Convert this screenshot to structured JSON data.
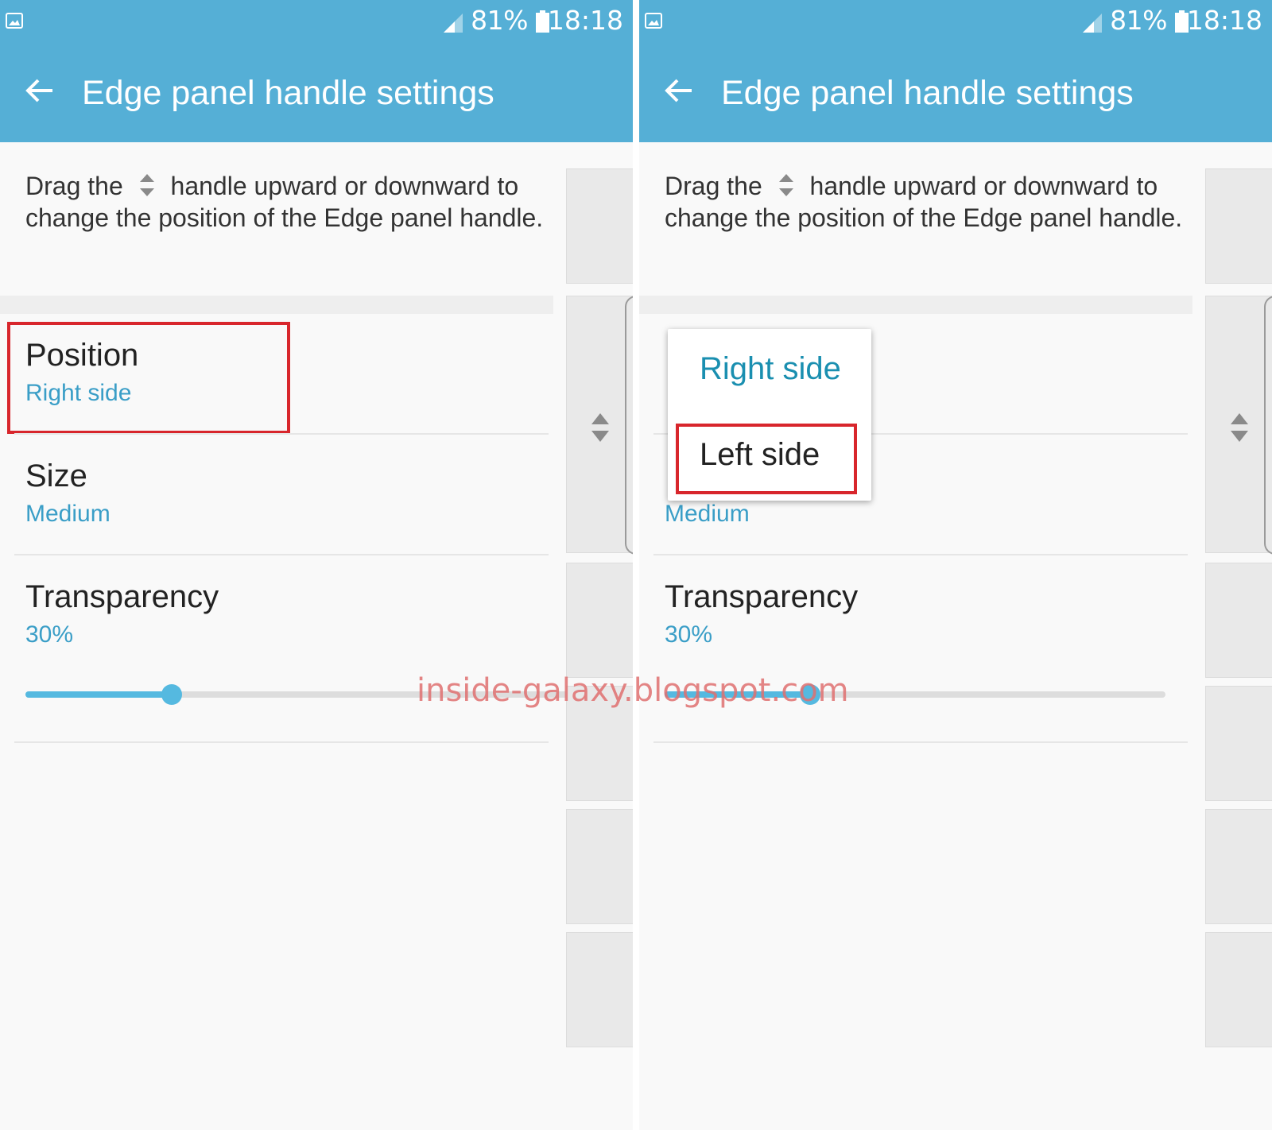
{
  "status_bar": {
    "battery": "81%",
    "time": "18:18"
  },
  "app_bar": {
    "title": "Edge panel handle settings"
  },
  "hint": {
    "part1": "Drag the",
    "part2": "handle upward or downward to change the position of the Edge panel handle."
  },
  "settings": {
    "position": {
      "title": "Position",
      "value": "Right side"
    },
    "size": {
      "title": "Size",
      "value": "Medium"
    },
    "transparency": {
      "title": "Transparency",
      "value": "30%",
      "slider_level": 0.3
    }
  },
  "position_popup": {
    "options": [
      "Right side",
      "Left side"
    ],
    "selected": "Right side",
    "highlighted": "Left side"
  },
  "watermark": "inside-galaxy.blogspot.com",
  "colors": {
    "accent": "#55afd6",
    "value_text": "#3a9ec7",
    "highlight_box": "#d8262c",
    "popup_selected": "#1a8fb0"
  }
}
